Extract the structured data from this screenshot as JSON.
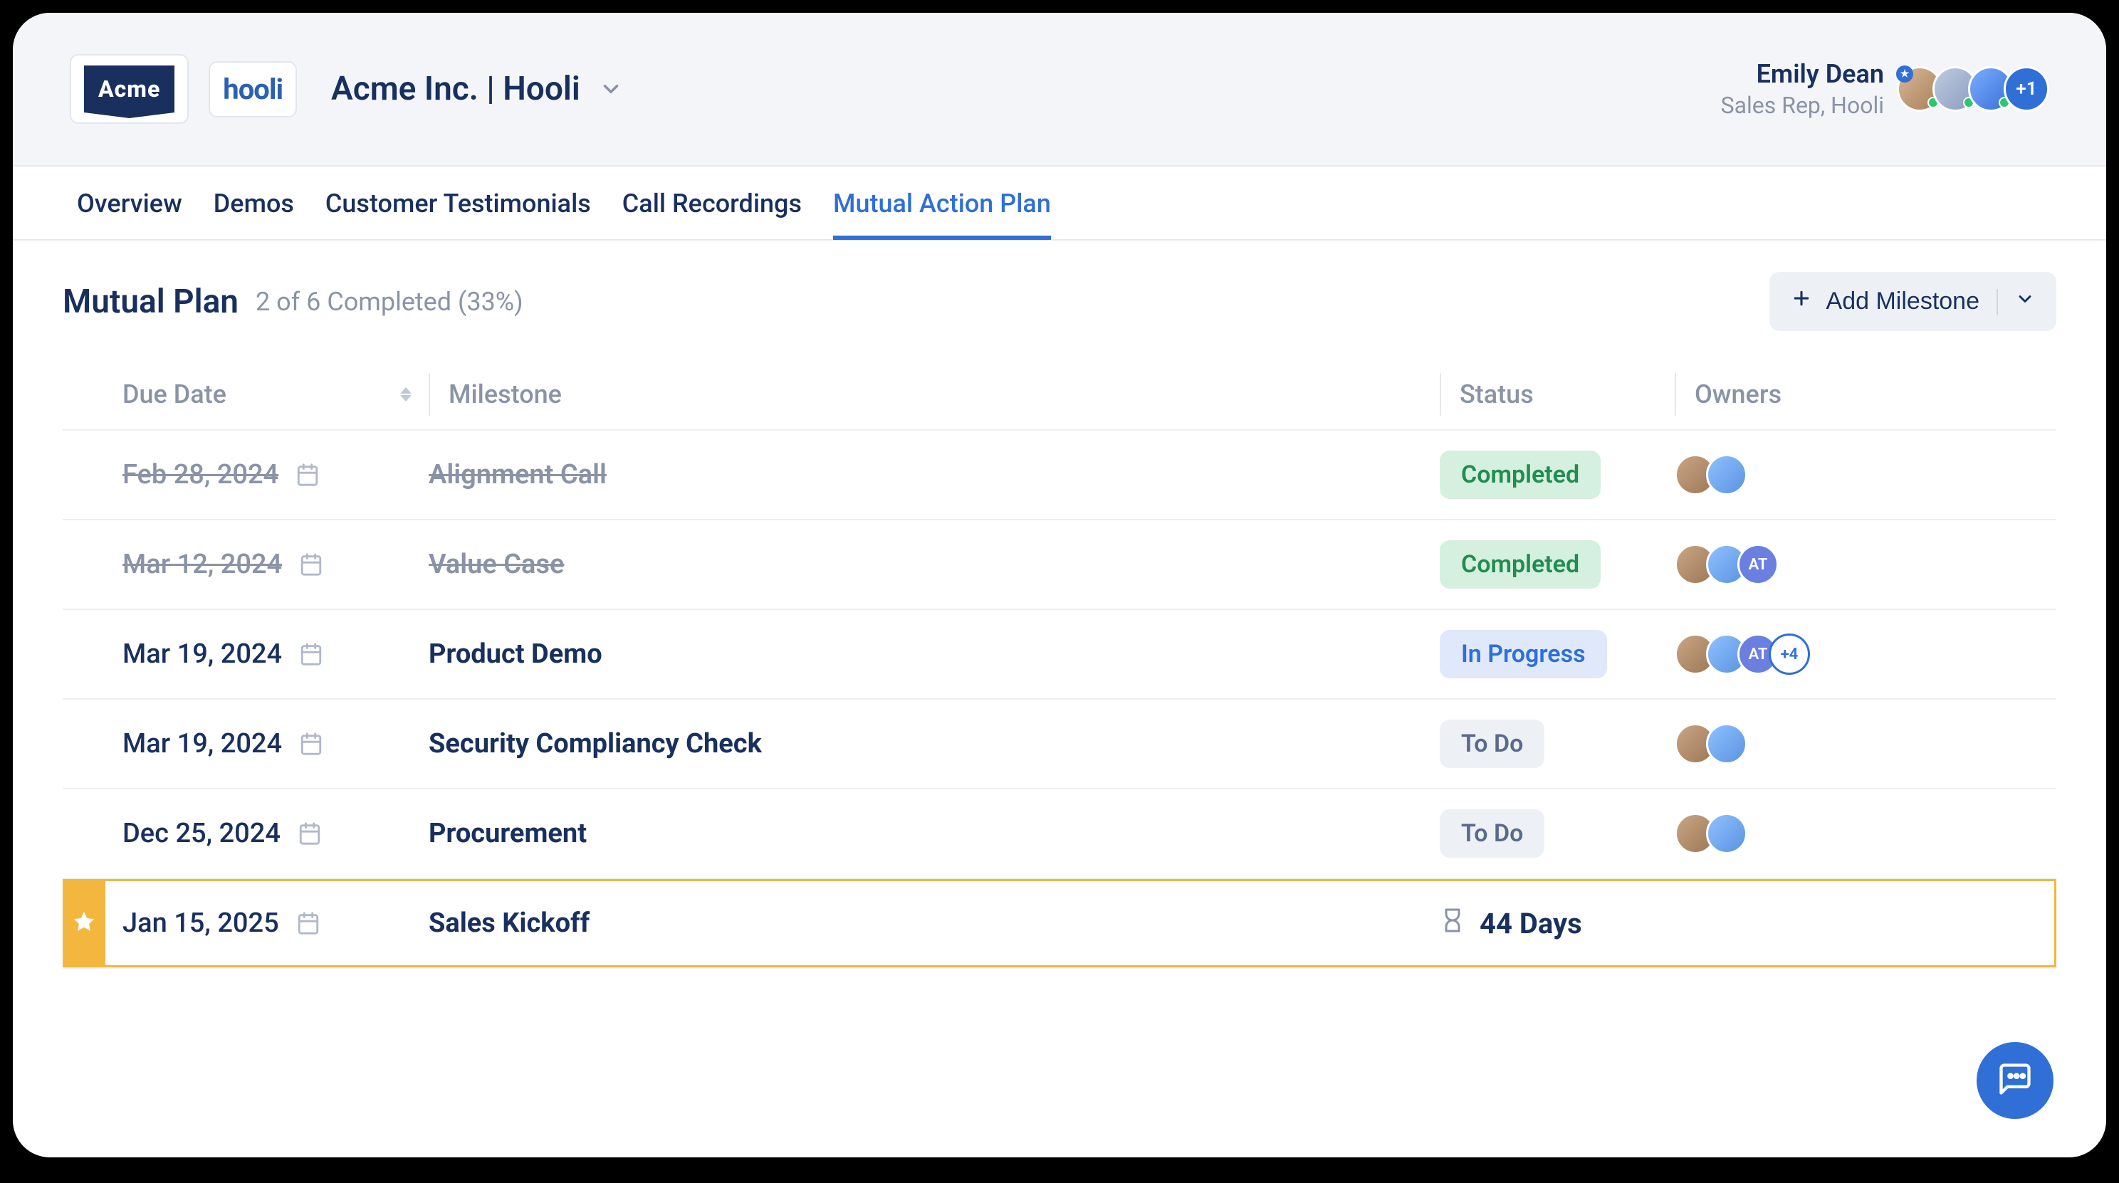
{
  "header": {
    "logo1": "Acme",
    "logo2": "hooli",
    "deal_title": "Acme Inc. | Hooli",
    "user_name": "Emily Dean",
    "user_role": "Sales Rep, Hooli",
    "avatar_overflow": "+1"
  },
  "tabs": [
    {
      "label": "Overview",
      "active": false
    },
    {
      "label": "Demos",
      "active": false
    },
    {
      "label": "Customer Testimonials",
      "active": false
    },
    {
      "label": "Call Recordings",
      "active": false
    },
    {
      "label": "Mutual Action Plan",
      "active": true
    }
  ],
  "plan": {
    "title": "Mutual Plan",
    "progress": "2 of 6 Completed (33%)",
    "add_button": "Add Milestone"
  },
  "columns": {
    "due": "Due Date",
    "milestone": "Milestone",
    "status": "Status",
    "owners": "Owners"
  },
  "status_labels": {
    "completed": "Completed",
    "inprogress": "In Progress",
    "todo": "To Do"
  },
  "rows": [
    {
      "date": "Feb 28, 2024",
      "milestone": "Alignment Call",
      "status": "completed",
      "struck": true,
      "owners": [
        "a1",
        "a2"
      ],
      "initials": null,
      "plus": null,
      "starred": false,
      "countdown": null
    },
    {
      "date": "Mar 12, 2024",
      "milestone": "Value Case",
      "status": "completed",
      "struck": true,
      "owners": [
        "a1",
        "a2"
      ],
      "initials": "AT",
      "plus": null,
      "starred": false,
      "countdown": null
    },
    {
      "date": "Mar 19, 2024",
      "milestone": "Product Demo",
      "status": "inprogress",
      "struck": false,
      "owners": [
        "a1",
        "a2"
      ],
      "initials": "AT",
      "plus": "+4",
      "starred": false,
      "countdown": null
    },
    {
      "date": "Mar 19, 2024",
      "milestone": "Security Compliancy Check",
      "status": "todo",
      "struck": false,
      "owners": [
        "a1",
        "a2"
      ],
      "initials": null,
      "plus": null,
      "starred": false,
      "countdown": null
    },
    {
      "date": "Dec 25, 2024",
      "milestone": "Procurement",
      "status": "todo",
      "struck": false,
      "owners": [
        "a1",
        "a2"
      ],
      "initials": null,
      "plus": null,
      "starred": false,
      "countdown": null
    },
    {
      "date": "Jan 15, 2025",
      "milestone": "Sales Kickoff",
      "status": null,
      "struck": false,
      "owners": [],
      "initials": null,
      "plus": null,
      "starred": true,
      "countdown": "44 Days"
    }
  ]
}
